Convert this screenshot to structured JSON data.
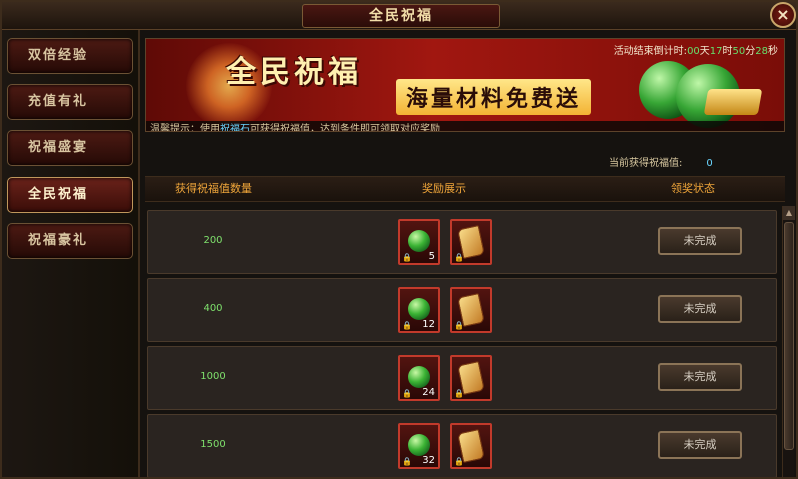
{
  "window": {
    "title": "全民祝福",
    "close_label": "×"
  },
  "sidebar": {
    "tabs": [
      {
        "label": "双倍经验"
      },
      {
        "label": "充值有礼"
      },
      {
        "label": "祝福盛宴"
      },
      {
        "label": "全民祝福",
        "active": true
      },
      {
        "label": "祝福豪礼"
      }
    ]
  },
  "banner": {
    "headline": "全民祝福",
    "subline": "海量材料免费送",
    "countdown": {
      "prefix": "活动结束倒计时:",
      "days": "00",
      "days_unit": "天",
      "hours": "17",
      "hours_unit": "时",
      "minutes": "50",
      "minutes_unit": "分",
      "seconds": "28",
      "seconds_unit": "秒"
    },
    "tip_prefix": "温馨提示：使用",
    "tip_item": "祝福石",
    "tip_suffix": "可获得祝福值，达到条件即可领取对应奖励"
  },
  "current": {
    "label": "当前获得祝福值:",
    "value": "0"
  },
  "table": {
    "headers": {
      "amount": "获得祝福值数量",
      "rewards": "奖励展示",
      "status": "领奖状态"
    },
    "rows": [
      {
        "amount": "200",
        "gem_count": "5",
        "status": "未完成"
      },
      {
        "amount": "400",
        "gem_count": "12",
        "status": "未完成"
      },
      {
        "amount": "1000",
        "gem_count": "24",
        "status": "未完成"
      },
      {
        "amount": "1500",
        "gem_count": "32",
        "status": "未完成"
      }
    ]
  },
  "icons": {
    "reward_gem": "green-gem-icon",
    "reward_scroll": "scroll-icon",
    "lock": "lock-icon"
  },
  "colors": {
    "accent_gold": "#f0a63a",
    "countdown_digits": "#65e16d",
    "amount_text": "#7ee06c",
    "highlight_blue": "#6ad6ff"
  }
}
